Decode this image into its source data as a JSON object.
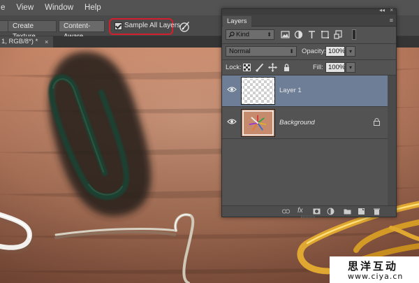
{
  "menubar": {
    "items": [
      "e",
      "View",
      "Window",
      "Help"
    ]
  },
  "options_bar": {
    "create_texture_label": "Create Texture",
    "content_aware_label": "Content-Aware",
    "sample_all_layers_label": "Sample All Layers",
    "sample_all_layers_checked": true,
    "highlight_color": "#d21e2d"
  },
  "document": {
    "tab_label": "1, RGB/8*) *",
    "close_glyph": "×"
  },
  "layers_panel": {
    "collapse_glyph": "◂◂",
    "close_glyph": "×",
    "tab_label": "Layers",
    "menu_glyph": "≡",
    "filter_kind": "Kind",
    "filter_icons": [
      "image-filter-icon",
      "adjustment-filter-icon",
      "type-filter-icon",
      "shape-filter-icon",
      "smart-object-filter-icon"
    ],
    "blend_mode": "Normal",
    "opacity_label": "Opacity:",
    "opacity_value": "100%",
    "lock_label": "Lock:",
    "fill_label": "Fill:",
    "fill_value": "100%",
    "layers": [
      {
        "name": "Layer 1",
        "selected": true,
        "visible": true,
        "locked": false,
        "thumbnail": "transparent"
      },
      {
        "name": "Background",
        "selected": false,
        "visible": true,
        "locked": true,
        "thumbnail": "photo"
      }
    ],
    "footer_icons": [
      "link-layers-icon",
      "fx-icon",
      "add-mask-icon",
      "adjustment-layer-icon",
      "new-group-icon",
      "new-layer-icon",
      "delete-layer-icon"
    ],
    "fx_label": "fx"
  },
  "watermark": {
    "line1": "思洋互动",
    "line2": "www.ciya.cn"
  },
  "colors": {
    "selected_layer": "#6d7e96",
    "panel_bg": "#535353",
    "canvas_bg": "#c98c70"
  }
}
